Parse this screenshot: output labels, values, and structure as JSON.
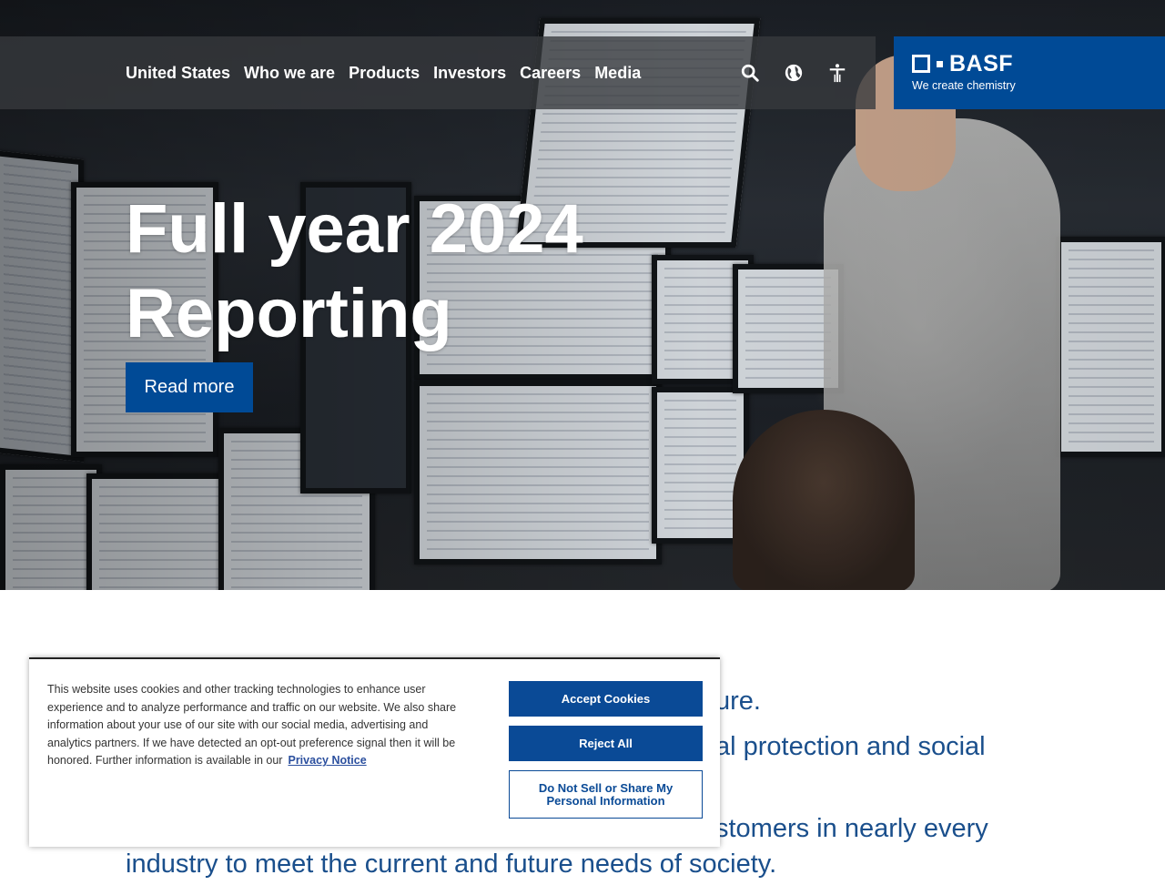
{
  "nav": {
    "links": [
      "United States",
      "Who we are",
      "Products",
      "Investors",
      "Careers",
      "Media"
    ],
    "icons": [
      "search-icon",
      "globe-icon",
      "accessibility-icon"
    ]
  },
  "logo": {
    "name": "BASF",
    "tagline": "We create chemistry"
  },
  "hero": {
    "title_line1": "Full year 2024",
    "title_line2": "Reporting",
    "cta": "Read more"
  },
  "body": {
    "line1": "ure.",
    "line2": "al protection and social",
    "line3": "stomers in nearly every",
    "line4": "industry to meet the current and future needs of society."
  },
  "cookie": {
    "text": "This website uses cookies and other tracking technologies to enhance user experience and to analyze performance and traffic on our website. We also share information about your use of our site with our social media, advertising and analytics partners. If we have detected an opt-out preference signal then it will be honored. Further information is available in our",
    "link": "Privacy Notice",
    "accept": "Accept Cookies",
    "reject": "Reject All",
    "do_not_sell": "Do Not Sell or Share My Personal Information"
  },
  "colors": {
    "brand_blue": "#004a96",
    "body_text_blue": "#1a4f8c"
  }
}
